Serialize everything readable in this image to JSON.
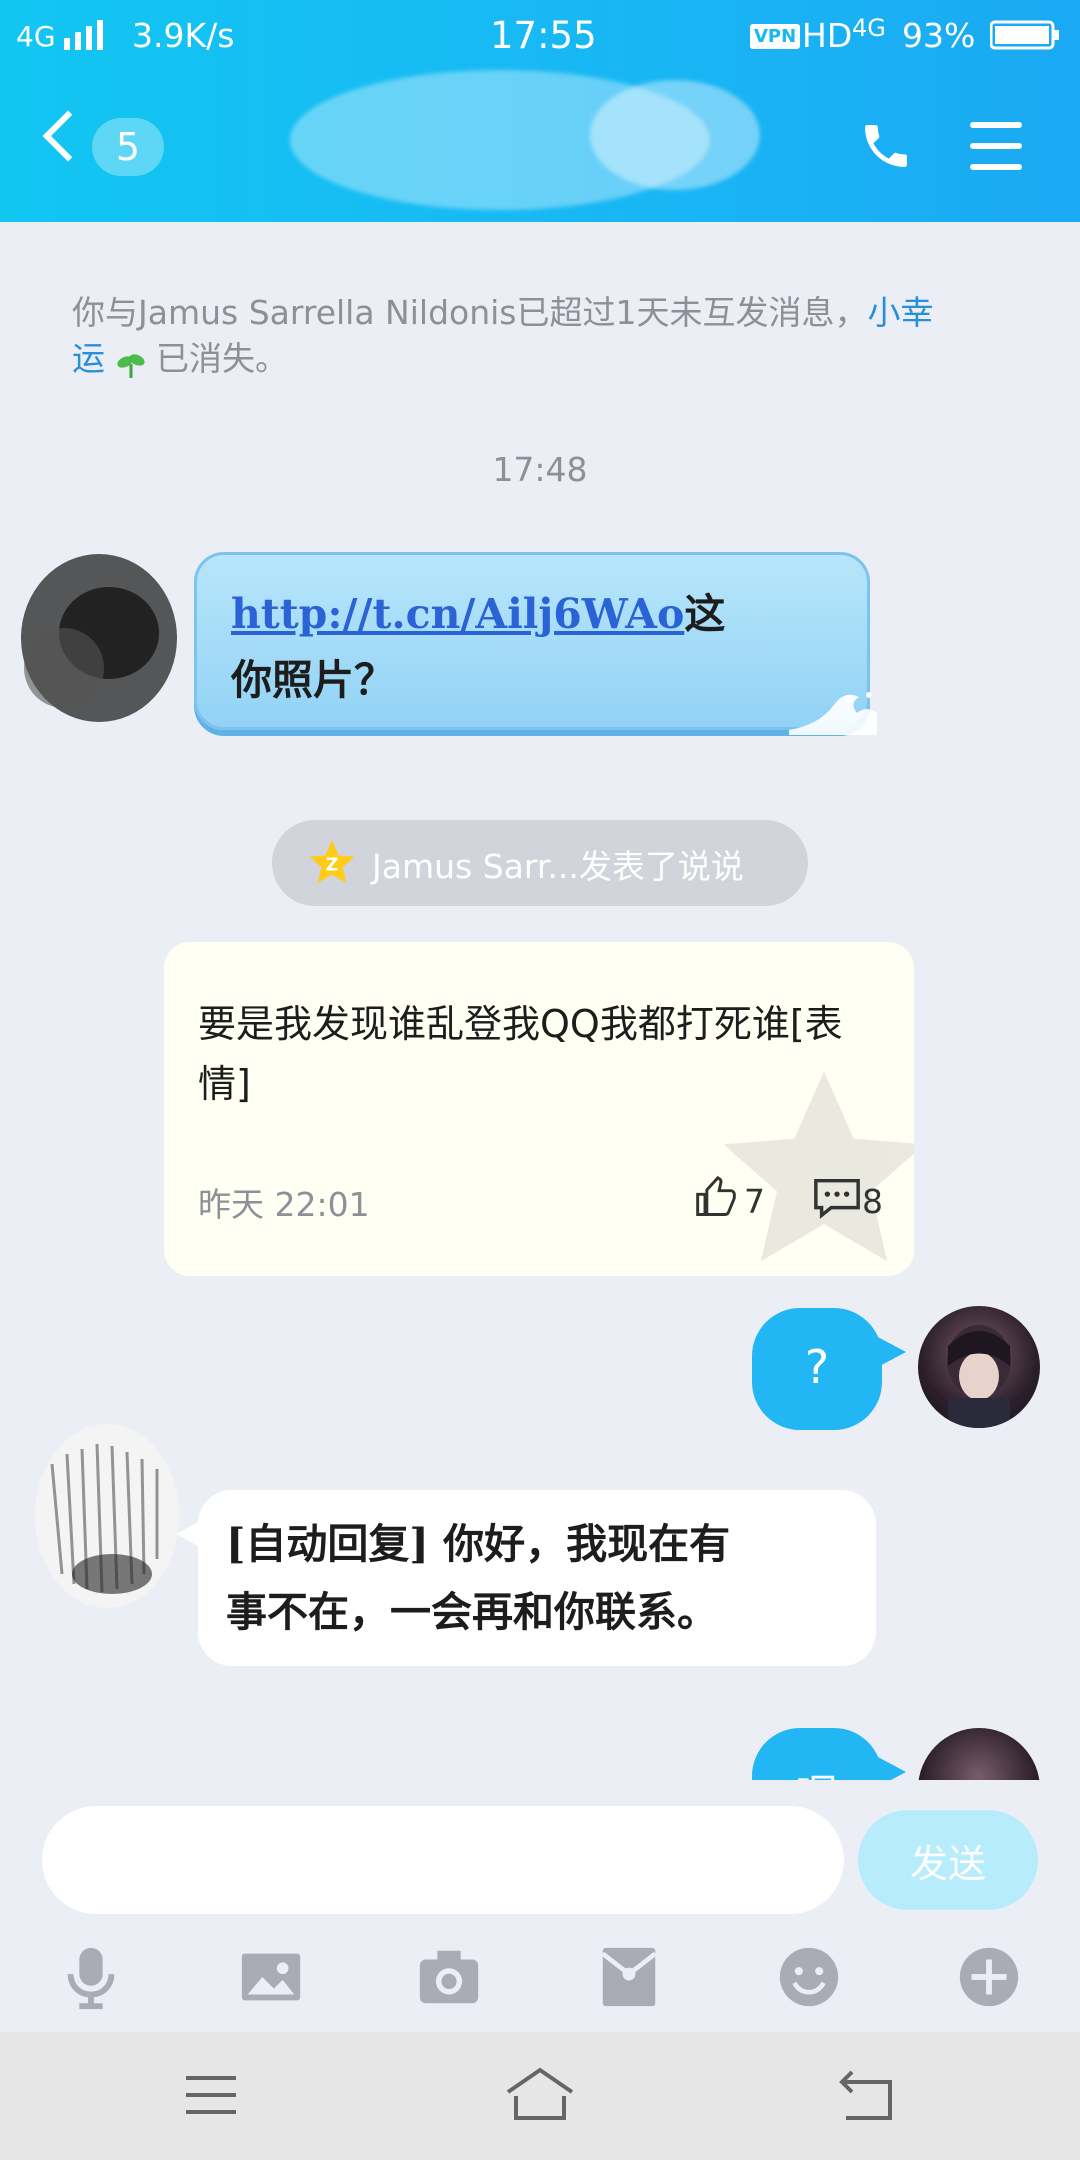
{
  "status_bar": {
    "network": "4G",
    "speed": "3.9K/s",
    "time": "17:55",
    "vpn": "VPN",
    "hd": "HD",
    "network_right": "4G",
    "battery": "93%"
  },
  "header": {
    "unread_count": "5",
    "call_icon": "phone-icon",
    "menu_icon": "hamburger-menu-icon"
  },
  "notice": {
    "prefix": "你与Jamus Sarrella Nildonis已超过1天未互发消息，",
    "link_part1": "小幸",
    "link_part2": "运",
    "suffix": "已消失。"
  },
  "timestamp": "17:48",
  "messages": {
    "m1_link": "http://t.cn/Ailj6WAo",
    "m1_after": "这",
    "m1_line2": "你照片？",
    "qzone_pill": "Jamus Sarr...发表了说说",
    "post_text": "要是我发现谁乱登我QQ我都打死谁[表情]",
    "post_time": "昨天 22:01",
    "post_likes": "7",
    "post_comments": "8",
    "m2_out": "?",
    "m3_line1": "[自动回复] 你好，我现在有",
    "m3_line2": "事不在，一会再和你联系。",
    "m4_out_partial": "嗯"
  },
  "input": {
    "placeholder": "",
    "send_label": "发送"
  },
  "toolbar": [
    "microphone-icon",
    "image-icon",
    "camera-icon",
    "red-packet-icon",
    "emoji-icon",
    "plus-icon"
  ],
  "colors": {
    "header": "#1ab5f4",
    "outgoing_bubble": "#23b6f5",
    "link_blue": "#2a8fd9",
    "background": "#eceef6"
  }
}
